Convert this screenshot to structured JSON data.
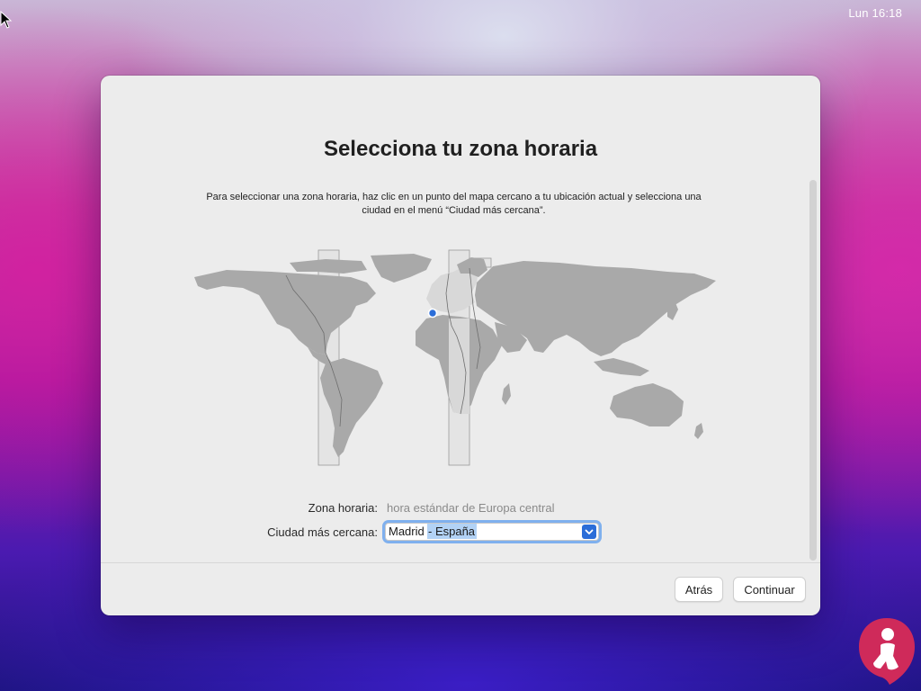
{
  "menubar": {
    "clock": "Lun 16:18"
  },
  "dialog": {
    "title": "Selecciona tu zona horaria",
    "description": "Para seleccionar una zona horaria, haz clic en un punto del mapa cercano a tu ubicación actual y selecciona una ciudad en el menú “Ciudad más cercana”.",
    "timezone_label": "Zona horaria:",
    "timezone_value": "hora estándar de Europa central",
    "city_label": "Ciudad más cercana:",
    "city_value": {
      "city": "Madrid",
      "country": " - España"
    },
    "buttons": {
      "back": "Atrás",
      "continue": "Continuar"
    }
  },
  "icons": {
    "cursor": "arrow-cursor-icon",
    "dropdown": "chevron-up-down-icon",
    "location_pin": "location-dot-icon",
    "logo": "help-person-logo"
  },
  "colors": {
    "accent": "#2b6dd8",
    "focus_ring": "#7fb0ee",
    "selection": "#b2d2f5",
    "land": "#a9a9a9",
    "selected_zone": "#d8d8d8",
    "window_bg": "#ececec"
  }
}
